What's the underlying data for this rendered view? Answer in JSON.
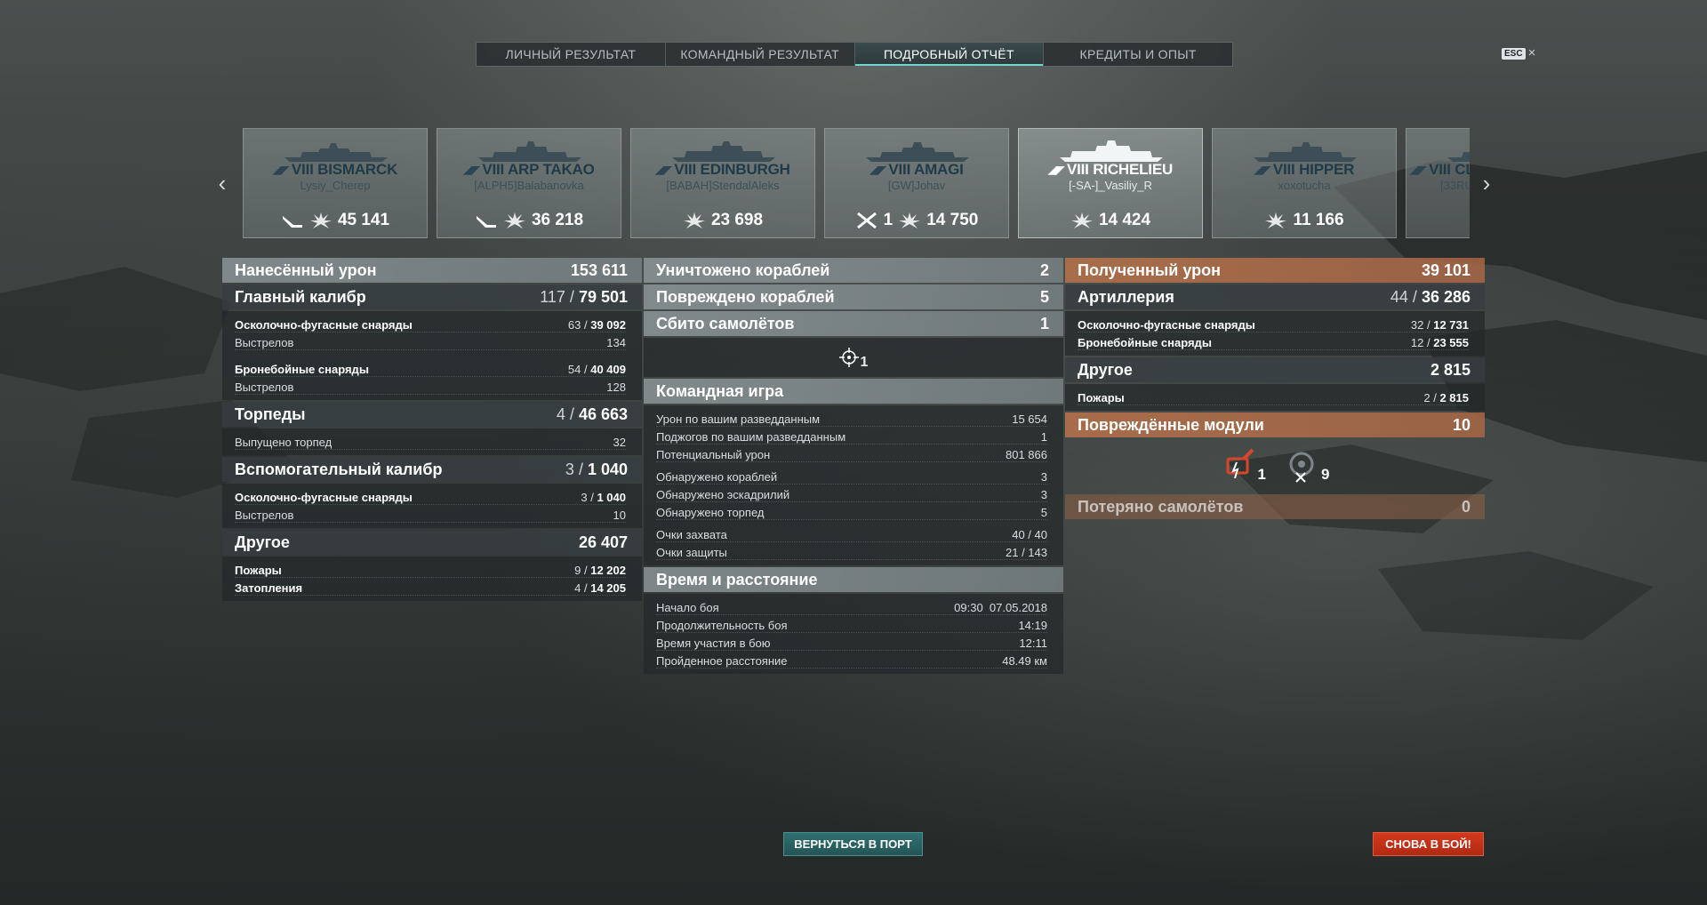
{
  "tabs": [
    {
      "label": "ЛИЧНЫЙ РЕЗУЛЬТАТ"
    },
    {
      "label": "КОМАНДНЫЙ РЕЗУЛЬТАТ"
    },
    {
      "label": "ПОДРОБНЫЙ ОТЧЁТ"
    },
    {
      "label": "КРЕДИТЫ И ОПЫТ"
    }
  ],
  "active_tab": 2,
  "esc_label": "ESC",
  "close_glyph": "×",
  "ships": [
    {
      "name": "VIII BISMARCK",
      "player": "Lysiy_Cherep",
      "kills": "",
      "damage": "45 141",
      "icons": [
        "torpedo-hit-icon",
        "damage-icon"
      ]
    },
    {
      "name": "VIII ARP TAKAO",
      "player": "[ALPH5]Balabanovka",
      "kills": "",
      "damage": "36 218",
      "icons": [
        "torpedo-hit-icon",
        "damage-icon"
      ]
    },
    {
      "name": "VIII EDINBURGH",
      "player": "[BABAH]StendalAleks",
      "kills": "",
      "damage": "23 698",
      "icons": [
        "damage-icon"
      ]
    },
    {
      "name": "VIII AMAGI",
      "player": "[GW]Johav",
      "kills": "1",
      "damage": "14 750",
      "icons": [
        "kill-icon",
        "damage-icon"
      ]
    },
    {
      "name": "VIII RICHELIEU",
      "player": "[-SA-]_Vasiliy_R",
      "kills": "",
      "damage": "14 424",
      "icons": [
        "damage-icon"
      ]
    },
    {
      "name": "VIII HIPPER",
      "player": "xoxotucha",
      "kills": "",
      "damage": "11 166",
      "icons": [
        "damage-icon"
      ]
    },
    {
      "name": "VIII CL",
      "player": "[33RU",
      "kills": "",
      "damage": "",
      "icons": []
    }
  ],
  "damage_dealt": {
    "title": "Нанесённый урон",
    "total": "153 611",
    "main": {
      "title": "Главный калибр",
      "hits": "117",
      "value": "79 501"
    },
    "he": {
      "label": "Осколочно-фугасные снаряды",
      "hits": "63",
      "value": "39 092"
    },
    "he_shots": {
      "label": "Выстрелов",
      "value": "134"
    },
    "ap": {
      "label": "Бронебойные снаряды",
      "hits": "54",
      "value": "40 409"
    },
    "ap_shots": {
      "label": "Выстрелов",
      "value": "128"
    },
    "torpedoes": {
      "title": "Торпеды",
      "hits": "4",
      "value": "46 663"
    },
    "torp_fired": {
      "label": "Выпущено торпед",
      "value": "32"
    },
    "secondary": {
      "title": "Вспомогательный калибр",
      "hits": "3",
      "value": "1 040"
    },
    "sec_he": {
      "label": "Осколочно-фугасные снаряды",
      "hits": "3",
      "value": "1 040"
    },
    "sec_shots": {
      "label": "Выстрелов",
      "value": "10"
    },
    "other": {
      "title": "Другое",
      "value": "26 407"
    },
    "fires": {
      "label": "Пожары",
      "hits": "9",
      "value": "12 202"
    },
    "floods": {
      "label": "Затопления",
      "hits": "4",
      "value": "14 205"
    }
  },
  "center": {
    "destroyed": {
      "label": "Уничтожено кораблей",
      "value": "2"
    },
    "damaged": {
      "label": "Повреждено кораблей",
      "value": "5"
    },
    "planes": {
      "label": "Сбито самолётов",
      "value": "1"
    },
    "plane_count": "1",
    "team": {
      "title": "Командная игра",
      "rows1": [
        {
          "label": "Урон по вашим разведданным",
          "value": "15 654"
        },
        {
          "label": "Поджогов по вашим разведданным",
          "value": "1"
        },
        {
          "label": "Потенциальный урон",
          "value": "801 866"
        }
      ],
      "rows2": [
        {
          "label": "Обнаружено кораблей",
          "value": "3"
        },
        {
          "label": "Обнаружено эскадрилий",
          "value": "3"
        },
        {
          "label": "Обнаружено торпед",
          "value": "5"
        }
      ],
      "rows3": [
        {
          "label": "Очки захвата",
          "value": "40 / 40"
        },
        {
          "label": "Очки защиты",
          "value": "21 / 143"
        }
      ]
    },
    "time": {
      "title": "Время и расстояние",
      "rows": [
        {
          "label": "Начало боя",
          "value": "09:30  07.05.2018"
        },
        {
          "label": "Продолжительность боя",
          "value": "14:19"
        },
        {
          "label": "Время участия в бою",
          "value": "12:11"
        },
        {
          "label": "Пройденное расстояние",
          "value": "48.49 км"
        }
      ]
    }
  },
  "received": {
    "title": "Полученный урон",
    "total": "39 101",
    "artillery": {
      "title": "Артиллерия",
      "hits": "44",
      "value": "36 286"
    },
    "he": {
      "label": "Осколочно-фугасные снаряды",
      "hits": "32",
      "value": "12 731"
    },
    "ap": {
      "label": "Бронебойные снаряды",
      "hits": "12",
      "value": "23 555"
    },
    "other": {
      "title": "Другое",
      "value": "2 815"
    },
    "fires": {
      "label": "Пожары",
      "hits": "2",
      "value": "2 815"
    },
    "modules": {
      "title": "Повреждённые модули",
      "value": "10"
    },
    "module_items": [
      {
        "icon": "gun-module-icon",
        "count": "1"
      },
      {
        "icon": "engine-module-icon",
        "count": "9"
      }
    ],
    "planes_lost": {
      "title": "Потеряно самолётов",
      "value": "0"
    }
  },
  "buttons": {
    "port": "ВЕРНУТЬСЯ В ПОРТ",
    "battle": "СНОВА В БОЙ!"
  },
  "colors": {
    "accent": "#6fd6d2",
    "battle_button": "#c8321a",
    "received_header": "#b9734b"
  }
}
